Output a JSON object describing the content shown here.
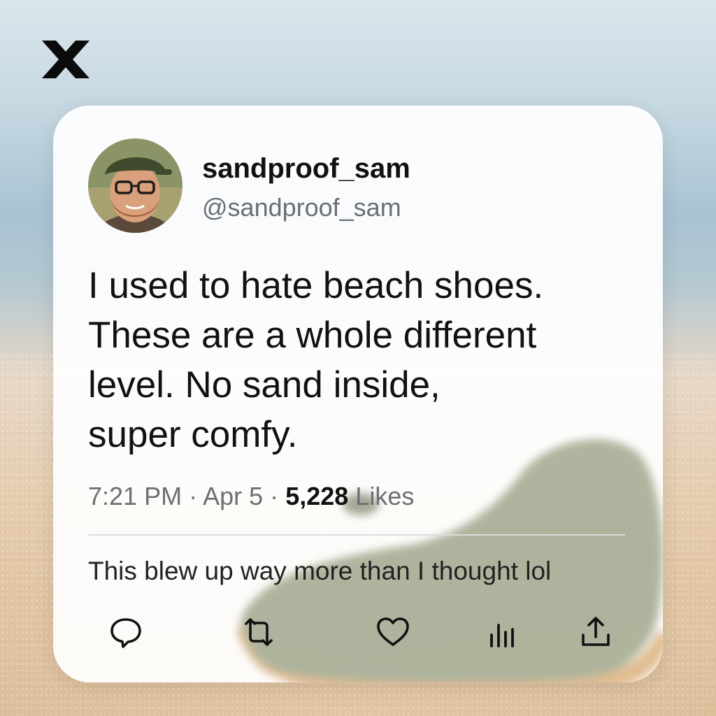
{
  "brand": {
    "logo_icon": "x-logo-icon"
  },
  "post": {
    "author": {
      "display_name": "sandproof_sam",
      "handle": "@sandproof_sam",
      "avatar_icon": "avatar-photo"
    },
    "text_lines": [
      "I used to hate beach shoes.",
      "These are a whole different",
      "level. No sand inside,",
      "super comfy."
    ],
    "meta": {
      "time": "7:21 PM",
      "separator": "·",
      "date": "Apr 5",
      "likes_count": "5,228",
      "likes_label": "Likes"
    },
    "reply_preview": "This blew up way more than I thought lol",
    "actions": [
      {
        "name": "reply",
        "icon": "reply-icon"
      },
      {
        "name": "repost",
        "icon": "repost-icon"
      },
      {
        "name": "like",
        "icon": "heart-icon"
      },
      {
        "name": "views",
        "icon": "analytics-icon"
      },
      {
        "name": "share",
        "icon": "share-icon"
      }
    ]
  },
  "colors": {
    "text_primary": "#111111",
    "text_secondary": "#6b6f74",
    "card_bg": "#ffffff",
    "divider": "#dcdcdc"
  }
}
